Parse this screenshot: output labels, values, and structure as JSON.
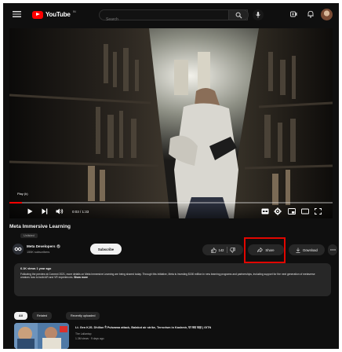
{
  "app": {
    "brand": "YouTube",
    "region": "IN"
  },
  "search": {
    "placeholder": "Search"
  },
  "player": {
    "overlay_label": "Play (k)",
    "time": "0:03 / 1:33",
    "progress_fraction": 0.04
  },
  "video": {
    "title": "Meta Immersive Learning",
    "visibility": "Unlisted"
  },
  "channel": {
    "name": "Meta Developers",
    "subscribers": "155K subscribers",
    "subscribe_label": "Subscribe"
  },
  "actions": {
    "likes": "142",
    "share_label": "Share",
    "download_label": "Download"
  },
  "description": {
    "stats": "6.1K views  1 year ago",
    "text": "Following the preview at Connect 2021, more details on Meta Immersive Learning are being shared today. Through this initiative, Meta is investing $150 million in new learning programs and partnerships, including support for the next generation of metaverse creators how to build AR and VR experiences.",
    "more_label": "Show more"
  },
  "chips": [
    "All",
    "Related",
    "Recently uploaded"
  ],
  "recommendation": {
    "title": "Lt. Gen KJS. Dhillon ने Pulwama attack, Balakot air strike, Terrorism in Kashmir, पर क्या कहा | GITN",
    "channel": "The Lallantop",
    "meta": "1.3M views · 9 days ago"
  },
  "colors": {
    "background": "#0f0f0f",
    "surface": "#272727",
    "brand_red": "#ff0000",
    "highlight_box": "#e10600"
  },
  "icons": [
    "menu-icon",
    "youtube-logo-icon",
    "search-icon",
    "mic-icon",
    "create-icon",
    "bell-icon",
    "play-icon",
    "next-icon",
    "volume-icon",
    "captions-icon",
    "settings-icon",
    "miniplayer-icon",
    "theater-icon",
    "fullscreen-icon",
    "like-icon",
    "dislike-icon",
    "share-icon",
    "download-icon",
    "more-icon",
    "meta-logo-icon",
    "verified-icon"
  ]
}
